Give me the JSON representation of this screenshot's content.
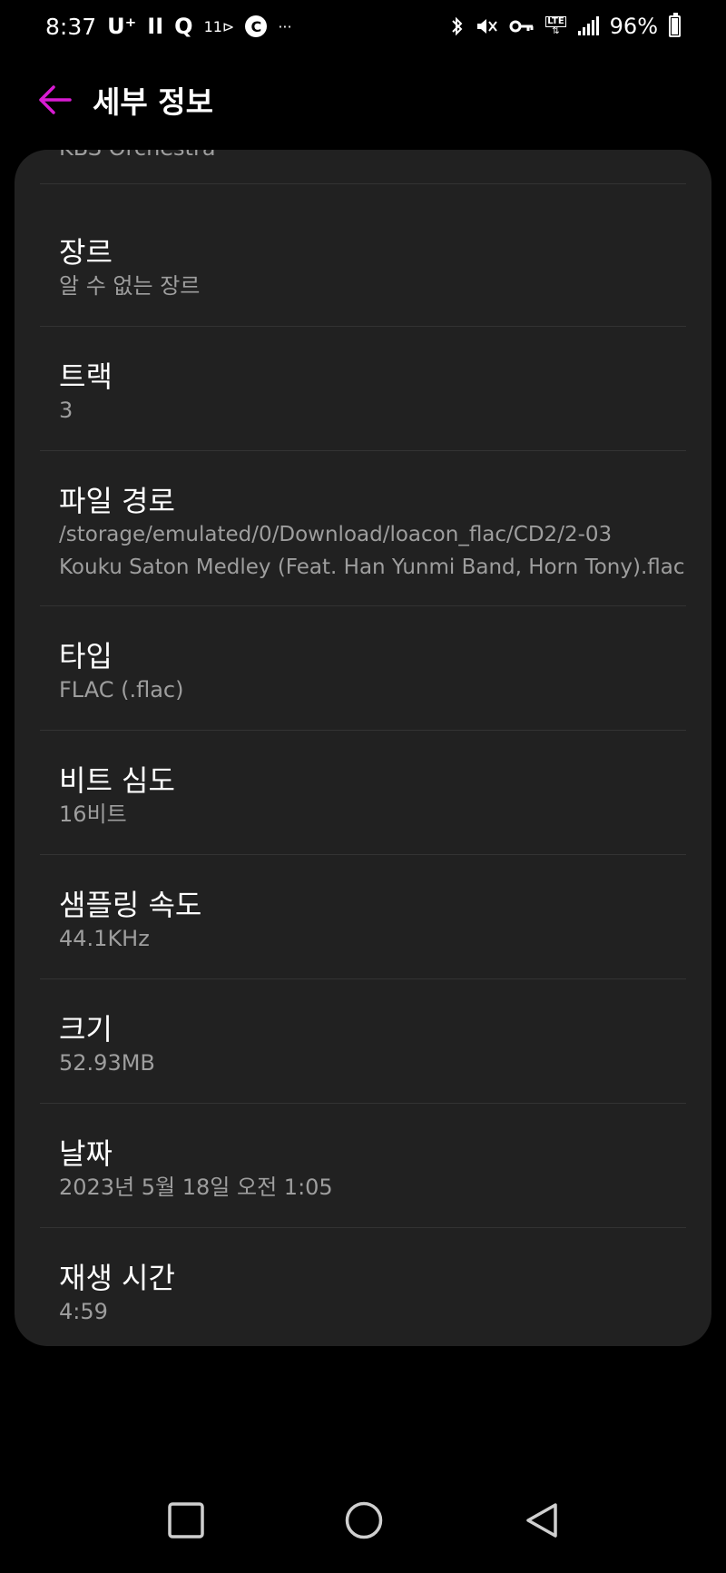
{
  "status_bar": {
    "time": "8:37",
    "carrier": "U⁺",
    "pause_glyph": "II",
    "q_glyph": "Q",
    "eleven_glyph": "11⊳",
    "c_glyph": "C",
    "more_glyph": "···",
    "battery_pct": "96%",
    "lte": "LTE"
  },
  "app_bar": {
    "title": "세부 정보",
    "accent_color": "#d81bd2"
  },
  "details": {
    "artist_value": "KBS Orchestra",
    "items": [
      {
        "label": "장르",
        "value": "알 수 없는 장르"
      },
      {
        "label": "트랙",
        "value": "3"
      },
      {
        "label": "파일 경로",
        "value_line1": "/storage/emulated/0/Download/loacon_flac/CD2/2-03",
        "value_line2": "Kouku Saton Medley (Feat. Han Yunmi Band, Horn Tony).flac"
      },
      {
        "label": "타입",
        "value": "FLAC (.flac)"
      },
      {
        "label": "비트 심도",
        "value": "16비트"
      },
      {
        "label": "샘플링 속도",
        "value": "44.1KHz"
      },
      {
        "label": "크기",
        "value": "52.93MB"
      },
      {
        "label": "날짜",
        "value": "2023년 5월 18일 오전 1:05"
      },
      {
        "label": "재생 시간",
        "value": "4:59"
      }
    ]
  },
  "nav": {
    "recents": "recents-square-icon",
    "home": "home-circle-icon",
    "back": "back-triangle-icon"
  }
}
